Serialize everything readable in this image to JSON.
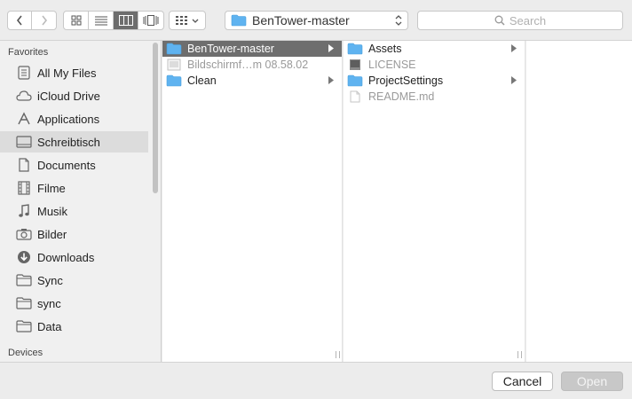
{
  "toolbar": {
    "back_icon": "chevron-left-icon",
    "forward_icon": "chevron-right-icon",
    "views": [
      {
        "icon": "icon-view-icon",
        "active": false
      },
      {
        "icon": "list-view-icon",
        "active": false
      },
      {
        "icon": "column-view-icon",
        "active": true
      },
      {
        "icon": "cover-flow-icon",
        "active": false
      }
    ],
    "arrange_icon": "arrange-grid-icon",
    "path_label": "BenTower-master",
    "search_placeholder": "Search"
  },
  "sidebar": {
    "favorites_title": "Favorites",
    "devices_title": "Devices",
    "items": [
      {
        "label": "All My Files",
        "icon": "all-files-icon",
        "selected": false
      },
      {
        "label": "iCloud Drive",
        "icon": "cloud-icon",
        "selected": false
      },
      {
        "label": "Applications",
        "icon": "applications-icon",
        "selected": false
      },
      {
        "label": "Schreibtisch",
        "icon": "desktop-icon",
        "selected": true
      },
      {
        "label": "Documents",
        "icon": "documents-icon",
        "selected": false
      },
      {
        "label": "Filme",
        "icon": "film-icon",
        "selected": false
      },
      {
        "label": "Musik",
        "icon": "music-icon",
        "selected": false
      },
      {
        "label": "Bilder",
        "icon": "camera-icon",
        "selected": false
      },
      {
        "label": "Downloads",
        "icon": "downloads-icon",
        "selected": false
      },
      {
        "label": "Sync",
        "icon": "folder-icon",
        "selected": false
      },
      {
        "label": "sync",
        "icon": "folder-icon",
        "selected": false
      },
      {
        "label": "Data",
        "icon": "folder-icon",
        "selected": false
      }
    ]
  },
  "columns": [
    {
      "items": [
        {
          "label": "BenTower-master",
          "type": "folder",
          "selected": true,
          "has_children": true,
          "dim": false
        },
        {
          "label": "Bildschirmf…m 08.58.02",
          "type": "image",
          "selected": false,
          "has_children": false,
          "dim": true
        },
        {
          "label": "Clean",
          "type": "folder",
          "selected": false,
          "has_children": true,
          "dim": false
        }
      ]
    },
    {
      "items": [
        {
          "label": "Assets",
          "type": "folder",
          "selected": false,
          "has_children": true,
          "dim": false
        },
        {
          "label": "LICENSE",
          "type": "binary",
          "selected": false,
          "has_children": false,
          "dim": true
        },
        {
          "label": "ProjectSettings",
          "type": "folder",
          "selected": false,
          "has_children": true,
          "dim": false
        },
        {
          "label": "README.md",
          "type": "document",
          "selected": false,
          "has_children": false,
          "dim": true
        }
      ]
    }
  ],
  "buttons": {
    "cancel": "Cancel",
    "open": "Open"
  },
  "colors": {
    "folder_blue": "#5fb3f0",
    "selection_gray": "#6e6e6e",
    "sidebar_selection": "#dcdcdc"
  }
}
